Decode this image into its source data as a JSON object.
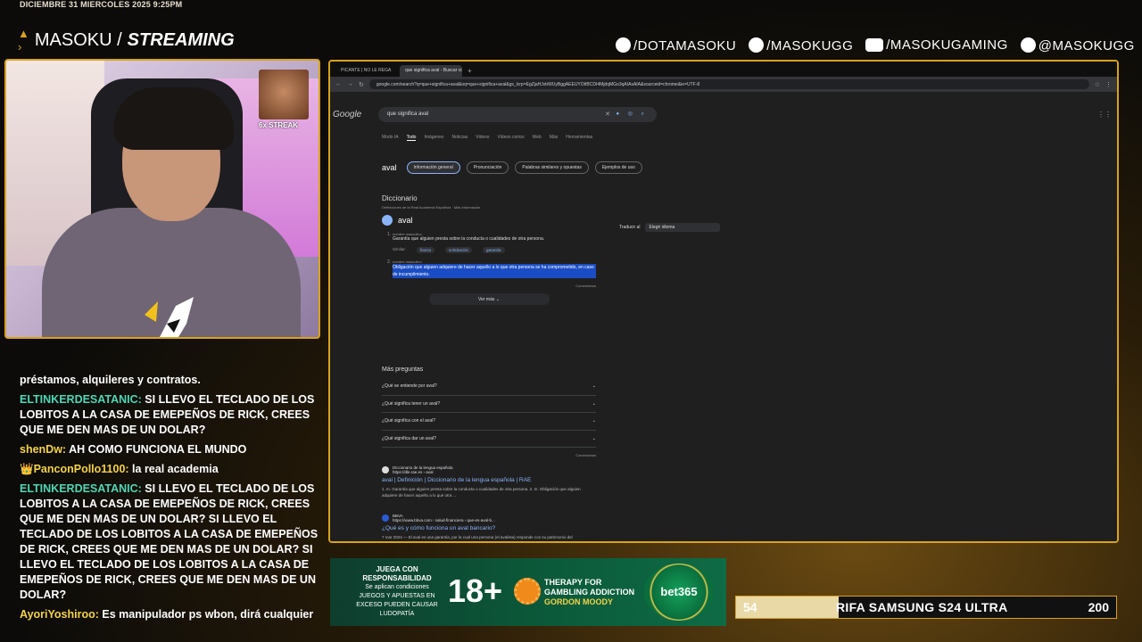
{
  "overlay": {
    "datetime": "DICIEMBRE 31 MIERCOLES 2025 9:25PM",
    "brand_regular": "MASOKU /",
    "brand_bold": "STREAMING",
    "socials": [
      {
        "icon": "facebook-icon",
        "handle": "/DOTAMASOKU"
      },
      {
        "icon": "instagram-icon",
        "handle": "/MASOKUGG"
      },
      {
        "icon": "youtube-icon",
        "handle": "/MASOKUGAMING"
      },
      {
        "icon": "tiktok-icon",
        "handle": "@MASOKUGG"
      }
    ]
  },
  "webcam": {
    "streak_label": "6x STREAK"
  },
  "chat": [
    {
      "user": "",
      "text": "préstamos, alquileres y contratos."
    },
    {
      "user": "ELTINKERDESATANIC:",
      "text": "SI LLEVO EL TECLADO DE LOS LOBITOS A LA CASA DE EMEPEÑOS DE RICK, CREES QUE ME DEN MAS DE UN DOLAR?"
    },
    {
      "user": "shenDw:",
      "text": "AH COMO FUNCIONA EL MUNDO"
    },
    {
      "user": "PanconPollo1100:",
      "text": "la real academia"
    },
    {
      "user": "ELTINKERDESATANIC:",
      "text": "SI LLEVO EL TECLADO DE LOS LOBITOS A LA CASA DE EMEPEÑOS DE RICK, CREES QUE ME DEN MAS DE UN DOLAR? SI LLEVO EL TECLADO DE LOS LOBITOS A LA CASA DE EMEPEÑOS DE RICK, CREES QUE ME DEN MAS DE UN DOLAR? SI LLEVO EL TECLADO DE LOS LOBITOS A LA CASA DE EMEPEÑOS DE RICK, CREES QUE ME DEN MAS DE UN DOLAR?"
    },
    {
      "user": "AyoriYoshiroo:",
      "text": "Es manipulador ps wbon, dirá cualquier cosa"
    }
  ],
  "browser": {
    "tabs": [
      "PICANTE | NO LE REGA",
      "que significa aval - Buscar con"
    ],
    "url": "google.com/search?q=que+significa+aval&oq=que+significa+aval&gs_lcrp=EgZjaHJvbWUyBggAEEUYOtIBCDI4MjdqMGo3qAIAsAIA&sourceid=chrome&ie=UTF-8",
    "google_logo": "Google",
    "query": "que significa aval",
    "search_tabs": [
      "Modo IA",
      "Todo",
      "Imágenes",
      "Noticias",
      "Videos",
      "Videos cortos",
      "Web",
      "Más",
      "Herramientas"
    ],
    "heading_word": "aval",
    "chips": [
      "Información general",
      "Pronunciación",
      "Palabras similares y opuestas",
      "Ejemplos de uso"
    ],
    "dict_title": "Diccionario",
    "dict_source": "Definiciones de la Real Academia Española · Más información",
    "dict_word": "aval",
    "def1_gram": "nombre masculino",
    "def1": "Garantía que alguien presta sobre la conducta o cualidades de otra persona.",
    "similar_label": "Similar:",
    "similar": [
      "fianza",
      "solicitación",
      "garantía"
    ],
    "def2_gram": "nombre masculino",
    "def2": "Obligación que alguien adquiere de hacer aquello a lo que otra persona se ha comprometido, en caso de incumplimiento.",
    "comments": "Comentarios",
    "ver_mas": "Ver más",
    "translate_label": "Traducir al",
    "translate_select": "Elegir idioma",
    "paa_title": "Más preguntas",
    "paa": [
      "¿Qué se entiende por aval?",
      "¿Qué significa tener un aval?",
      "¿Qué significa con el aval?",
      "¿Qué significa dar un aval?"
    ],
    "paa_comments": "Comentarios",
    "results": [
      {
        "site": "Diccionario de la lengua española",
        "url": "https://dle.rae.es › aval",
        "title": "aval | Definición | Diccionario de la lengua española | RAE",
        "snippet": "1. m. Garantía que alguien presta sobre la conducta o cualidades de otra persona. 2. m. Obligación que alguien adquiere de hacer aquello a lo que otra ..."
      },
      {
        "site": "BBVA",
        "url": "https://www.bbva.com › salud-financiera › que-es-aval-b...",
        "title": "¿Qué es y cómo funciona un aval bancario?",
        "snippet": "7 mar 2024 — El aval es una garantía, por la cual una persona (el avalista) responde con su patrimonio del cumplimiento de una obligación principal que ha ..."
      }
    ]
  },
  "ad": {
    "line1": "JUEGA CON RESPONSABILIDAD",
    "line2": "Se aplican condiciones",
    "line3": "JUEGOS Y APUESTAS EN EXCESO PUEDEN CAUSAR LUDOPATÍA",
    "age": "18+",
    "therapy1": "THERAPY FOR",
    "therapy2": "GAMBLING ADDICTION",
    "therapy3": "GORDON MOODY",
    "brand": "bet365"
  },
  "raffle": {
    "current": "54",
    "title": "RIFA SAMSUNG S24 ULTRA",
    "goal": "200",
    "progress": 0.27
  }
}
